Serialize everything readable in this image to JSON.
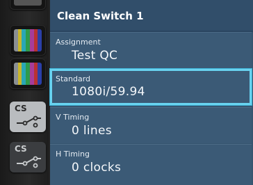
{
  "panel": {
    "title": "Clean Switch 1",
    "fields": [
      {
        "label": "Assignment",
        "value": "Test QC"
      },
      {
        "label": "Standard",
        "value": "1080i/59.94"
      },
      {
        "label": "V Timing",
        "value": "0 lines"
      },
      {
        "label": "H Timing",
        "value": "0 clocks"
      }
    ],
    "selected_index": 1
  },
  "sidebar": {
    "thumbnails": [
      {
        "type": "color-bars-icon"
      },
      {
        "type": "color-bars-icon"
      },
      {
        "type": "color-bars-icon"
      },
      {
        "type": "clean-switch-icon",
        "label": "CS"
      },
      {
        "type": "clean-switch-icon",
        "label": "CS"
      }
    ]
  },
  "colors": {
    "panel_background": "#36546f",
    "selection_outline": "#69d3f0",
    "color_bars": [
      "#8a8f94",
      "#c9b52b",
      "#2aa7b5",
      "#2e9b4b",
      "#a63c9a",
      "#b83232",
      "#2a3fa8"
    ]
  }
}
